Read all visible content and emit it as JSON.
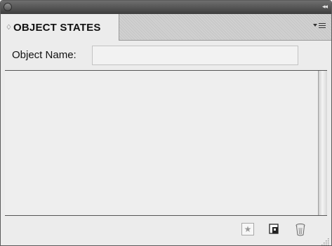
{
  "panel": {
    "tab_label": "OBJECT STATES",
    "tab_chevron": "♢",
    "collapse_glyph": "◂◂"
  },
  "object_name": {
    "label": "Object Name:",
    "value": "",
    "placeholder": ""
  },
  "footer": {
    "star_glyph": "★"
  },
  "icons": [
    "close-icon",
    "collapse-icon",
    "panel-menu-icon",
    "convert-to-state-icon",
    "new-state-icon",
    "trash-icon",
    "resize-grip-icon"
  ]
}
